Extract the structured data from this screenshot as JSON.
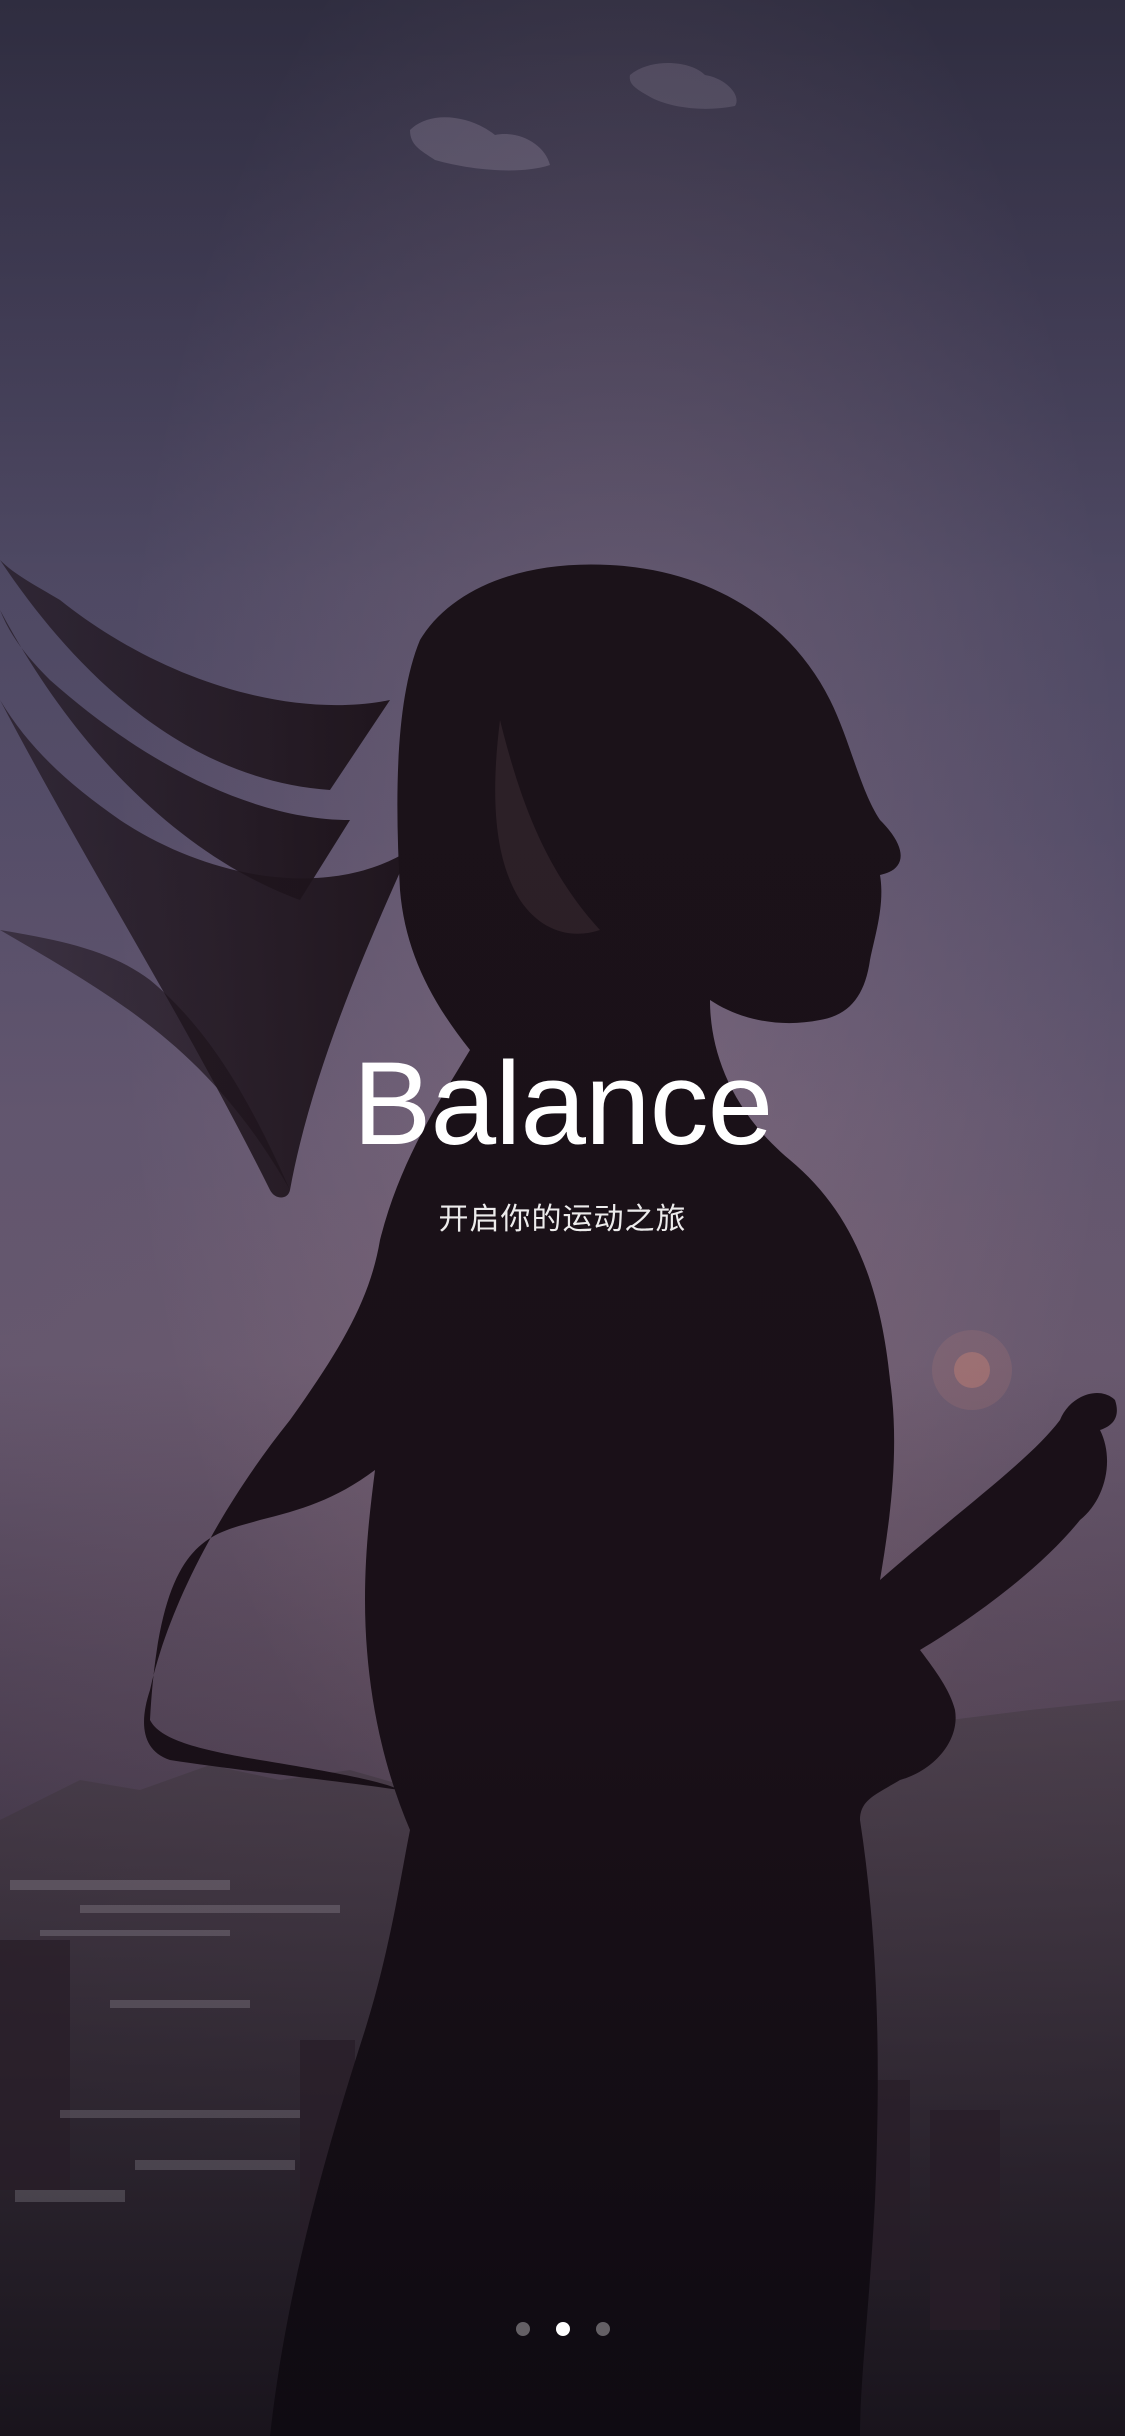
{
  "app": {
    "title": "Balance",
    "subtitle": "开启你的运动之旅"
  },
  "pagination": {
    "total": 3,
    "active_index": 1
  },
  "colors": {
    "text_primary": "#ffffff",
    "dot_inactive": "rgba(255,255,255,0.35)",
    "dot_active": "#ffffff"
  },
  "background": {
    "subject": "runner-silhouette",
    "setting": "dusk-city-skyline"
  }
}
